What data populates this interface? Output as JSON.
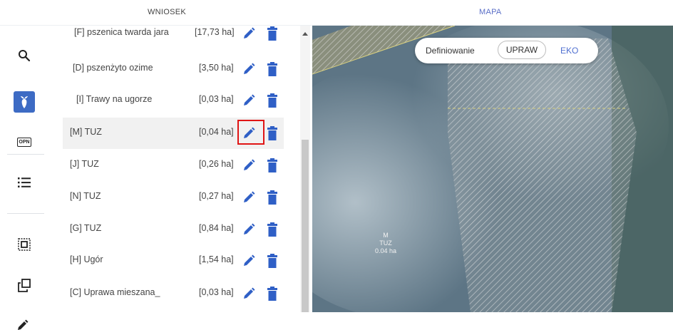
{
  "tabs": {
    "wniosek": "WNIOSEK",
    "mapa": "MAPA"
  },
  "rail": {
    "items": [
      {
        "icon": "search-icon"
      },
      {
        "icon": "plant-icon",
        "active": true
      },
      {
        "icon": "opn-icon",
        "label": "OPN"
      },
      {
        "icon": "list-icon"
      },
      {
        "icon": "select-area-icon"
      },
      {
        "icon": "copy-icon"
      },
      {
        "icon": "pencil-icon"
      }
    ],
    "active_color": "#3d6bc4"
  },
  "parcels": [
    {
      "name": "[F] pszenica twarda jara",
      "area": "[17,73 ha]"
    },
    {
      "name": "[D] pszenżyto ozime",
      "area": "[3,50 ha]"
    },
    {
      "name": "[I] Trawy na ugorze",
      "area": "[0,03 ha]"
    },
    {
      "name": "[M] TUZ",
      "area": "[0,04 ha]",
      "selected": true
    },
    {
      "name": "[J] TUZ",
      "area": "[0,26 ha]"
    },
    {
      "name": "[N] TUZ",
      "area": "[0,27 ha]"
    },
    {
      "name": "[G] TUZ",
      "area": "[0,84 ha]"
    },
    {
      "name": "[H] Ugór",
      "area": "[1,54 ha]"
    },
    {
      "name": "[C] Uprawa mieszana_",
      "area": "[0,03 ha]"
    }
  ],
  "colors": {
    "action_icon": "#2f5fc6",
    "highlight": "#e01515"
  },
  "map": {
    "parcel_label": {
      "letter": "M",
      "crop": "TUZ",
      "area": "0.04 ha"
    },
    "mode_switch": {
      "label": "Definiowanie",
      "options": [
        "UPRAW",
        "EKO"
      ],
      "selected": "UPRAW"
    }
  }
}
